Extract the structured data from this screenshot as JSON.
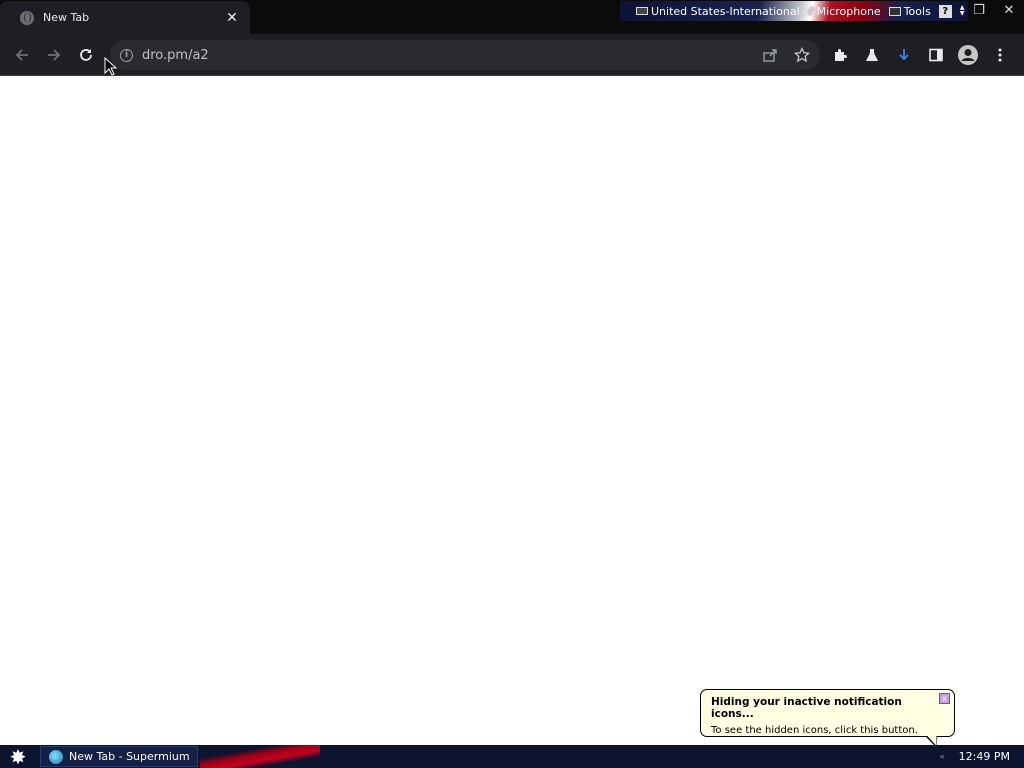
{
  "browser": {
    "tab": {
      "title": "New Tab",
      "close_symbol": "✕"
    },
    "omnibox": {
      "url": "dro.pm/a2"
    }
  },
  "language_bar": {
    "items": [
      "United States-International",
      "Microphone",
      "Tools"
    ],
    "help_symbol": "?"
  },
  "window_controls": {
    "minimize": "–",
    "restore": "❐",
    "close": "✕"
  },
  "balloon": {
    "title": "Hiding your inactive notification icons...",
    "body": "To see the hidden icons, click this button.",
    "close_symbol": "x"
  },
  "taskbar": {
    "start_symbol": "✸",
    "task_label": "New Tab - Supermium",
    "tray_arrow": "«",
    "clock": "12:49 PM"
  },
  "colors": {
    "toolbar_bg": "#1e1f22",
    "download_accent": "#3b82f6"
  }
}
